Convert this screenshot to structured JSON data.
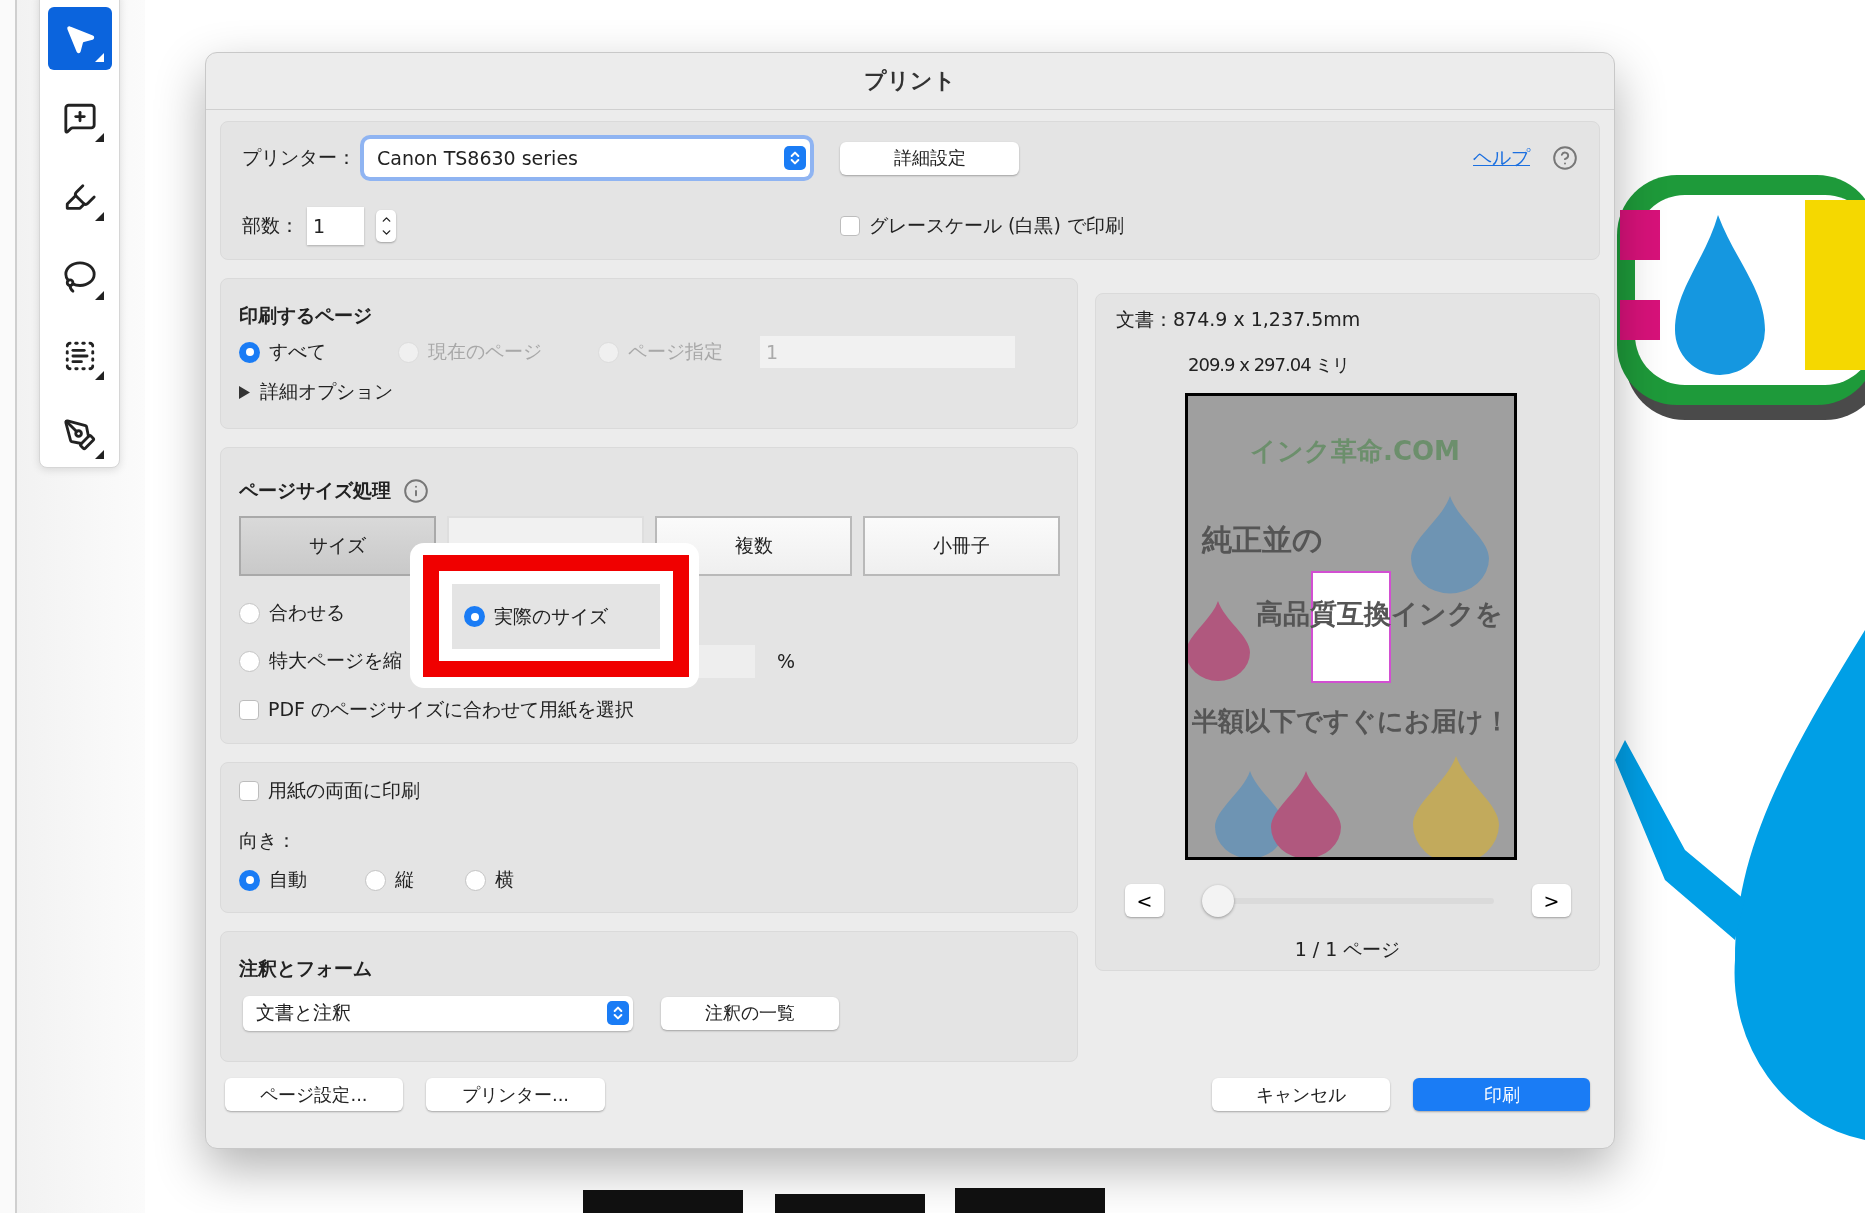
{
  "toolbar": {
    "tools": [
      {
        "kind": "select",
        "selected": true
      },
      {
        "kind": "comment",
        "selected": false
      },
      {
        "kind": "highlight",
        "selected": false
      },
      {
        "kind": "draw",
        "selected": false
      },
      {
        "kind": "textbox",
        "selected": false
      },
      {
        "kind": "sign",
        "selected": false
      }
    ]
  },
  "print_dialog": {
    "title": "プリント",
    "printer": {
      "label": "プリンター：",
      "value": "Canon TS8630 series"
    },
    "properties_button": "詳細設定",
    "help_link": "ヘルプ",
    "copies": {
      "label": "部数：",
      "value": "1"
    },
    "grayscale": {
      "label": "グレースケール (白黒) で印刷",
      "checked": false
    },
    "pages": {
      "title": "印刷するページ",
      "options": [
        {
          "label": "すべて",
          "selected": true,
          "disabled": false
        },
        {
          "label": "現在のページ",
          "selected": false,
          "disabled": true
        },
        {
          "label": "ページ指定",
          "selected": false,
          "disabled": true
        }
      ],
      "range_field": {
        "value": "1",
        "disabled": true
      },
      "more_options": {
        "label": "詳細オプション",
        "expanded": false
      }
    },
    "page_sizing": {
      "title": "ページサイズ処理",
      "tabs": [
        {
          "label": "サイズ",
          "selected": true
        },
        {
          "selected": false
        },
        {
          "label": "複数",
          "selected": false
        },
        {
          "label": "小冊子",
          "selected": false
        }
      ],
      "options": [
        {
          "label": "合わせる",
          "selected": false,
          "highlighted": false
        },
        {
          "label": "実際のサイズ",
          "selected": true,
          "highlighted": true
        },
        {
          "label": "特大ページを縮",
          "selected": false,
          "highlighted": false
        }
      ],
      "percent_unit": "%",
      "pdf_paper": {
        "label": "PDF のページサイズに合わせて用紙を選択",
        "checked": false
      }
    },
    "duplex": {
      "label": "用紙の両面に印刷",
      "checked": false
    },
    "orientation": {
      "label": "向き：",
      "options": [
        {
          "label": "自動",
          "selected": true
        },
        {
          "label": "縦",
          "selected": false
        },
        {
          "label": "横",
          "selected": false
        }
      ]
    },
    "annotations": {
      "title": "注釈とフォーム",
      "select": "文書と注釈",
      "summary_button": "注釈の一覧"
    },
    "preview": {
      "document_size": "文書：874.9 x 1,237.5mm",
      "paper_size": "209.9 x 297.04 ミリ",
      "page_texts": [
        "インク革命.COM",
        "純正並の",
        "高品質互換インクを",
        "半額以下ですぐにお届け！"
      ],
      "prev_button": "<",
      "next_button": ">",
      "slider": {
        "level": 0
      },
      "page_count": "1 / 1 ページ"
    },
    "footer": {
      "page_setup": "ページ設定...",
      "printer": "プリンター...",
      "cancel": "キャンセル",
      "print": "印刷"
    }
  }
}
